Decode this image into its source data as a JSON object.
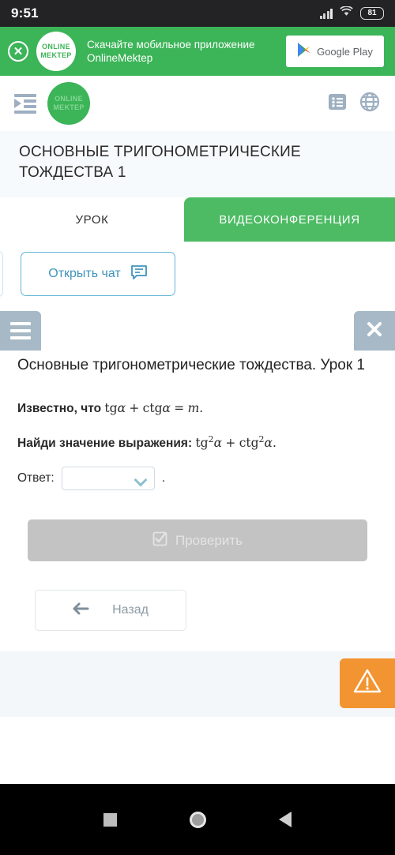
{
  "status_bar": {
    "time": "9:51",
    "battery": "81",
    "signal_icon": "cellular-signal-icon",
    "wifi_icon": "wifi-icon"
  },
  "promo_banner": {
    "close_icon": "close-circle-icon",
    "logo_line1": "ONLINE",
    "logo_line2": "MEKTEP",
    "text": "Скачайте мобильное приложение OnlineMektep",
    "store_label": "Google Play",
    "store_icon": "google-play-icon",
    "background_color": "#3cb458"
  },
  "app_header": {
    "menu_icon": "indent-menu-icon",
    "logo_line1": "ONLINE",
    "logo_line2": "MEKTEP",
    "list_icon": "list-view-icon",
    "globe_icon": "globe-language-icon"
  },
  "lesson": {
    "title": "ОСНОВНЫЕ ТРИГОНОМЕТРИЧЕСКИЕ ТОЖДЕСТВА 1"
  },
  "tabs": [
    {
      "label": "УРОК",
      "active": false
    },
    {
      "label": "ВИДЕОКОНФЕРЕНЦИЯ",
      "active": true
    }
  ],
  "chat": {
    "button_label": "Открыть чат",
    "icon": "chat-bubble-icon"
  },
  "panel": {
    "menu_icon": "hamburger-menu-icon",
    "close_icon": "close-icon"
  },
  "task": {
    "title": "Основные тригонометрические тождества. Урок 1",
    "statement1_bold": "Известно, что",
    "statement1_math_fn1": "tg",
    "statement1_math_var1": "α",
    "statement1_math_plus": "+",
    "statement1_math_fn2": "ctg",
    "statement1_math_var2": "α",
    "statement1_math_eq": "=",
    "statement1_math_m": "m.",
    "statement2_bold": "Найди значение выражения:",
    "statement2_math_fn1": "tg",
    "statement2_math_sup1": "2",
    "statement2_math_var1": "α",
    "statement2_math_plus": "+",
    "statement2_math_fn2": "ctg",
    "statement2_math_sup2": "2",
    "statement2_math_var2": "α.",
    "answer_label": "Ответ:",
    "answer_value": "",
    "answer_period": ".",
    "check_label": "Проверить",
    "check_icon": "checkbox-checked-icon",
    "back_label": "Назад",
    "back_icon": "arrow-left-icon"
  },
  "footer": {
    "warning_icon": "warning-triangle-icon",
    "warning_color": "#f29431"
  },
  "nav_bar": {
    "recents_icon": "square-recents-icon",
    "home_icon": "circle-home-icon",
    "back_icon": "triangle-back-icon"
  }
}
